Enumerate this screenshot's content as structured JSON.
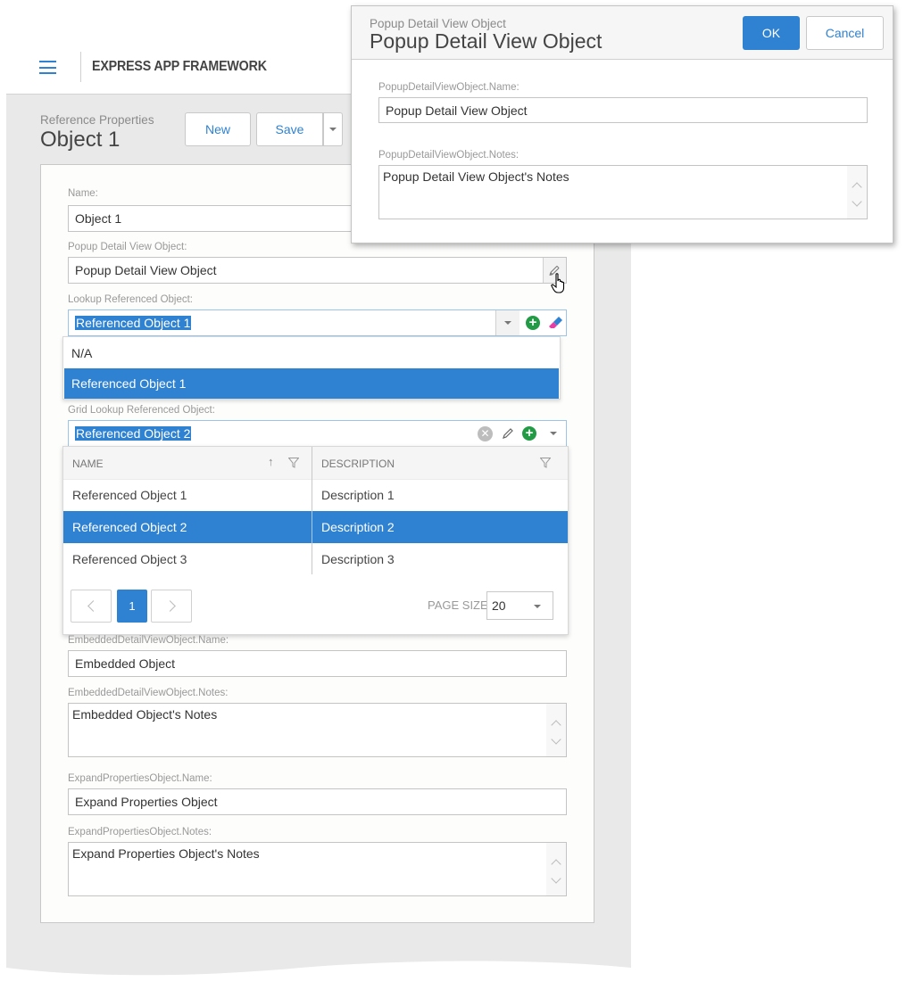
{
  "app": {
    "title": "EXPRESS APP FRAMEWORK",
    "breadcrumb": "Reference Properties",
    "page_title": "Object 1",
    "accent_color": "#2f82d1"
  },
  "toolbar": {
    "new_label": "New",
    "save_label": "Save"
  },
  "form": {
    "name": {
      "label": "Name:",
      "value": "Object 1"
    },
    "popup_detail": {
      "label": "Popup Detail View Object:",
      "value": "Popup Detail View Object"
    },
    "lookup": {
      "label": "Lookup Referenced Object:",
      "value": "Referenced Object 1",
      "options": [
        {
          "label": "N/A",
          "selected": false
        },
        {
          "label": "Referenced Object 1",
          "selected": true
        }
      ]
    },
    "grid_lookup": {
      "label": "Grid Lookup Referenced Object:",
      "value": "Referenced Object 2",
      "columns": [
        "NAME",
        "DESCRIPTION"
      ],
      "rows": [
        {
          "name": "Referenced Object 1",
          "description": "Description 1",
          "selected": false
        },
        {
          "name": "Referenced Object 2",
          "description": "Description 2",
          "selected": true
        },
        {
          "name": "Referenced Object 3",
          "description": "Description 3",
          "selected": false
        }
      ],
      "pager": {
        "current_page": "1",
        "page_size_label": "PAGE SIZE",
        "page_size": "20"
      }
    },
    "embedded_name": {
      "label": "EmbeddedDetailViewObject.Name:",
      "value": "Embedded Object"
    },
    "embedded_notes": {
      "label": "EmbeddedDetailViewObject.Notes:",
      "value": "Embedded Object's Notes"
    },
    "expand_name": {
      "label": "ExpandPropertiesObject.Name:",
      "value": "Expand Properties Object"
    },
    "expand_notes": {
      "label": "ExpandPropertiesObject.Notes:",
      "value": "Expand Properties Object's Notes"
    }
  },
  "popup": {
    "breadcrumb": "Popup Detail View Object",
    "title": "Popup Detail View Object",
    "ok_label": "OK",
    "cancel_label": "Cancel",
    "name": {
      "label": "PopupDetailViewObject.Name:",
      "value": "Popup Detail View Object"
    },
    "notes": {
      "label": "PopupDetailViewObject.Notes:",
      "value": "Popup Detail View Object's Notes"
    }
  }
}
